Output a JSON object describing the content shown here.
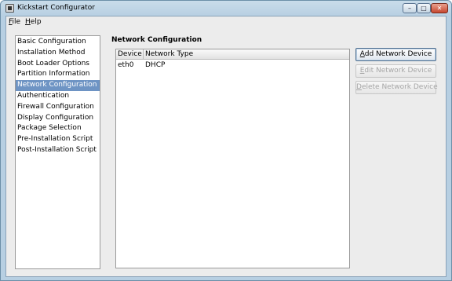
{
  "window": {
    "title": "Kickstart Configurator",
    "controls": {
      "minimize": "–",
      "maximize": "□",
      "close": "✕"
    }
  },
  "menubar": {
    "file": {
      "mnemonic": "F",
      "rest": "ile"
    },
    "help": {
      "mnemonic": "H",
      "rest": "elp"
    }
  },
  "sidebar": {
    "items": [
      {
        "label": "Basic Configuration"
      },
      {
        "label": "Installation Method"
      },
      {
        "label": "Boot Loader Options"
      },
      {
        "label": "Partition Information"
      },
      {
        "label": "Network Configuration",
        "selected": true
      },
      {
        "label": "Authentication"
      },
      {
        "label": "Firewall Configuration"
      },
      {
        "label": "Display Configuration"
      },
      {
        "label": "Package Selection"
      },
      {
        "label": "Pre-Installation Script"
      },
      {
        "label": "Post-Installation Script"
      }
    ]
  },
  "main": {
    "title": "Network Configuration",
    "table": {
      "columns": [
        "Device",
        "Network Type"
      ],
      "rows": [
        [
          "eth0",
          "DHCP"
        ]
      ]
    },
    "buttons": {
      "add": {
        "mnemonic": "A",
        "rest": "dd Network Device"
      },
      "edit": {
        "mnemonic": "E",
        "rest": "dit Network Device"
      },
      "delete": {
        "mnemonic": "D",
        "rest": "elete Network Device"
      }
    }
  },
  "colors": {
    "selection": "#6e94c4",
    "titlebar": "#c9dcea"
  }
}
